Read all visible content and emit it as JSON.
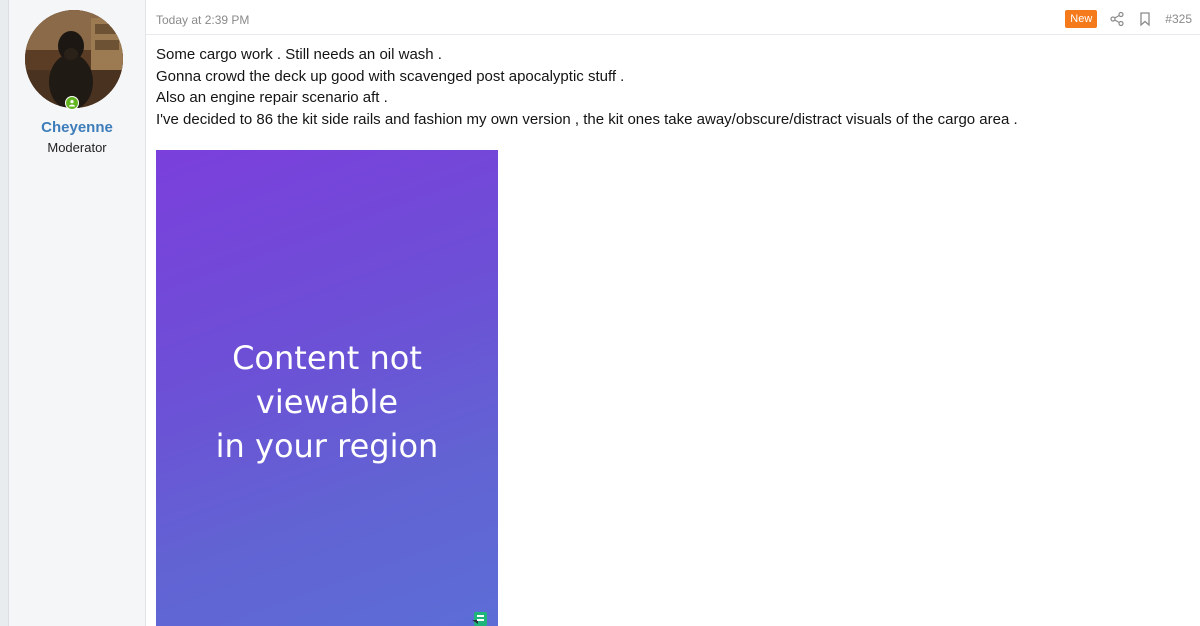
{
  "user": {
    "name": "Cheyenne",
    "title": "Moderator",
    "avatar_icon": "dog-photo-avatar",
    "online_status_icon": "online-indicator-icon"
  },
  "post": {
    "timestamp": "Today at 2:39 PM",
    "badge": "New",
    "number": "#325",
    "lines": [
      "Some cargo work . Still needs an oil wash .",
      "Gonna crowd the deck up good with scavenged post apocalyptic stuff .",
      "Also an engine repair scenario aft .",
      "I've decided to 86 the kit side rails and fashion my own version , the kit ones take away/obscure/distract visuals of the cargo area ."
    ]
  },
  "media": {
    "line1": "Content not viewable",
    "line2": "in your region"
  },
  "colors": {
    "badge": "#f47a1b",
    "username": "#3d7dba",
    "online": "#63b522"
  }
}
